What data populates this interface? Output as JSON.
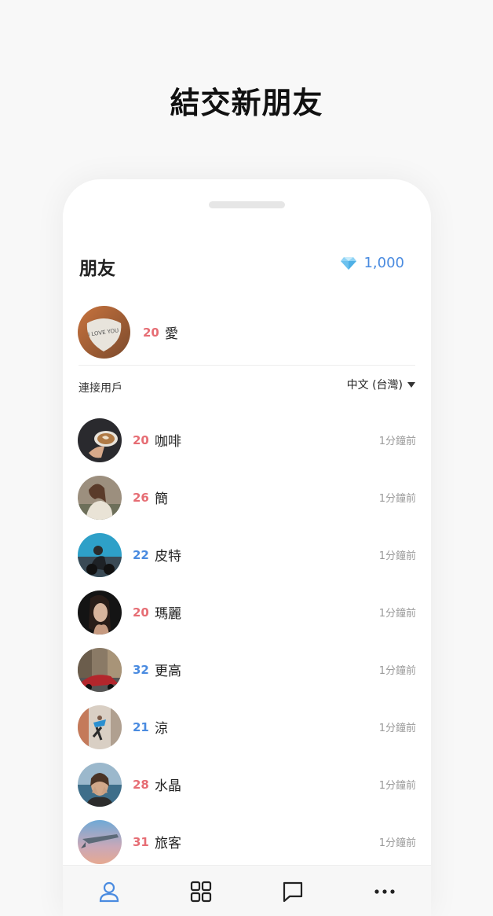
{
  "headline": "結交新朋友",
  "header": {
    "title": "朋友",
    "coins": "1,000",
    "coin_icon": "diamond-icon"
  },
  "me": {
    "age": "20",
    "name": "愛",
    "gender": "f"
  },
  "section": {
    "label": "連接用戶",
    "language": "中文 (台灣)"
  },
  "users": [
    {
      "age": "20",
      "name": "咖啡",
      "gender": "f",
      "time": "1分鐘前"
    },
    {
      "age": "26",
      "name": "簡",
      "gender": "f",
      "time": "1分鐘前"
    },
    {
      "age": "22",
      "name": "皮特",
      "gender": "m",
      "time": "1分鐘前"
    },
    {
      "age": "20",
      "name": "瑪麗",
      "gender": "f",
      "time": "1分鐘前"
    },
    {
      "age": "32",
      "name": "更高",
      "gender": "m",
      "time": "1分鐘前"
    },
    {
      "age": "21",
      "name": "涼",
      "gender": "m",
      "time": "1分鐘前"
    },
    {
      "age": "28",
      "name": "水晶",
      "gender": "f",
      "time": "1分鐘前"
    },
    {
      "age": "31",
      "name": "旅客",
      "gender": "f",
      "time": "1分鐘前"
    }
  ],
  "tabs": [
    "person-icon",
    "grid-icon",
    "chat-icon",
    "more-icon"
  ],
  "colors": {
    "female": "#e66d74",
    "male": "#4a8be0",
    "accent": "#4a8be0"
  }
}
